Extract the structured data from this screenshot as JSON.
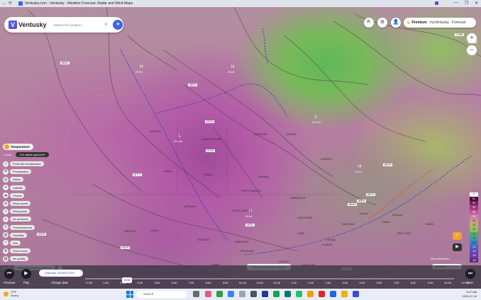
{
  "window": {
    "title": "Ventusky.com - Ventusky - Weather Forecast, Radar and Wind Maps",
    "controls": [
      "—",
      "❐",
      "✕"
    ]
  },
  "search": {
    "logo": "Ventusky",
    "placeholder": "Search for Location..."
  },
  "header": {
    "premium": "Premium",
    "my": "myVentusky",
    "forecast": "Forecast"
  },
  "map": {
    "pressure_labels": [
      {
        "text": "18500"
      },
      {
        "text": "18640"
      },
      {
        "text": "18900"
      },
      {
        "text": "19030"
      },
      {
        "text": "19160"
      },
      {
        "text": "18770"
      },
      {
        "text": "17980"
      },
      {
        "text": "18110"
      },
      {
        "text": "18240"
      },
      {
        "text": "18370"
      },
      {
        "text": "18500"
      },
      {
        "text": "18640"
      },
      {
        "text": "19290"
      },
      {
        "text": "19290"
      },
      {
        "text": "19420"
      },
      {
        "text": "19290"
      }
    ],
    "highs_lows": [
      {
        "text": "H",
        "sub": "29 km"
      },
      {
        "text": "L",
        "sub": "29.1 km"
      },
      {
        "text": "H",
        "sub": "29 km"
      },
      {
        "text": "L",
        "sub": "29.1 km"
      },
      {
        "text": "H",
        "sub": "29 km"
      },
      {
        "text": "H",
        "sub": "30 km"
      }
    ],
    "cities": [
      "ALBERTA",
      "SASKATCHEWAN",
      "MANITOBA",
      "ONTARIO",
      "CANADA",
      "MONTANA",
      "NORTH DAKOTA",
      "SOUTH DAKOTA",
      "NEBRASKA",
      "WYOMING",
      "IDAHO",
      "OREGON",
      "NEVADA",
      "UTAH",
      "COLORADO",
      "KANSAS",
      "MINNESOTA",
      "IOWA",
      "MISSOURI",
      "ILLINOIS",
      "MICHIGAN",
      "WISCONSIN",
      "Winnipeg",
      "Calgary",
      "Regina",
      "Chicago",
      "Toronto",
      "Montreal",
      "Denver",
      "Ottawa",
      "NEW YORK",
      "MAINE"
    ]
  },
  "layers": {
    "active": "Temperature",
    "level_label": "Level:",
    "level": "2 m above ground",
    "items": [
      {
        "icon": "thermometer-icon",
        "glyph": "≈",
        "label": "Feels like temperature"
      },
      {
        "icon": "rain-icon",
        "glyph": "☂",
        "label": "Precipitation"
      },
      {
        "icon": "radar-icon",
        "glyph": "◎",
        "label": "Radar"
      },
      {
        "icon": "satellite-icon",
        "glyph": "⌖",
        "label": "Satellite"
      },
      {
        "icon": "cloud-icon",
        "glyph": "☁",
        "label": "Clouds"
      },
      {
        "icon": "wind-icon",
        "glyph": "≋",
        "label": "Wind speed"
      },
      {
        "icon": "gust-icon",
        "glyph": "≈",
        "label": "Wind gusts"
      },
      {
        "icon": "pressure-icon",
        "glyph": "◐",
        "label": "Air pressure"
      },
      {
        "icon": "lightning-icon",
        "glyph": "ϟ",
        "label": "Thunderstorms"
      },
      {
        "icon": "humidity-icon",
        "glyph": "◍",
        "label": "Humidity"
      },
      {
        "icon": "sea-icon",
        "glyph": "≈",
        "label": "Sea"
      },
      {
        "icon": "snow-icon",
        "glyph": "❄",
        "label": "Snow cover"
      },
      {
        "icon": "air-quality-icon",
        "glyph": "▤",
        "label": "Air quality"
      }
    ],
    "model_label": "Model:",
    "model": "Automatic (ICON+HRRR)"
  },
  "present_button": "Show present day forecast",
  "legend": {
    "unit": "°C",
    "values": [
      "50",
      "40",
      "30",
      "25",
      "20",
      "15",
      "10",
      "5",
      "0",
      "-5",
      "-10",
      "-15",
      "-20",
      "-25",
      "-30"
    ],
    "colors": [
      "#4a0a3a",
      "#7a1d5e",
      "#a83682",
      "#c4579e",
      "#cf79b0",
      "#c99a86",
      "#b9b26c",
      "#8fbf5a",
      "#4fa96a",
      "#3ea09a",
      "#3a84b8",
      "#4a62c2",
      "#5d46b8",
      "#6f3aa6",
      "#5a2a88"
    ]
  },
  "wind_animation": {
    "label": "Wind Animation",
    "value": "Normal"
  },
  "timeline": {
    "previous": "Previous",
    "play": "Play",
    "change_date": "Change date",
    "next": "Next",
    "date": "Saturday, 2026/07/18",
    "current": "10:00",
    "hours": [
      "17:00",
      "1:00",
      "2:00",
      "4:00",
      "5:00",
      "6:00",
      "7:00",
      "8:00",
      "9:00",
      "10:00",
      "11:00",
      "12:00",
      "1:00",
      "2:00",
      "3:00",
      "4:00",
      "5:00",
      "6:00",
      "7:00",
      "8:00",
      "9:00",
      "10:00",
      "11:00"
    ]
  },
  "taskbar": {
    "temp": "73°F",
    "condition": "Sunny",
    "search": "Search",
    "time": "8:47 AM",
    "date": "2026-07-18"
  }
}
